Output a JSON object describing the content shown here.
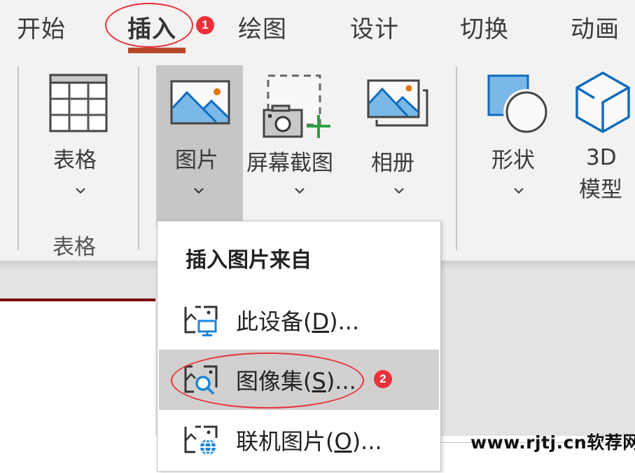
{
  "tabs": [
    {
      "label": "开始",
      "active": false
    },
    {
      "label": "插入",
      "active": true
    },
    {
      "label": "绘图",
      "active": false
    },
    {
      "label": "设计",
      "active": false
    },
    {
      "label": "切换",
      "active": false
    },
    {
      "label": "动画",
      "active": false
    }
  ],
  "annotations": {
    "step1": "1",
    "step2": "2",
    "color": "#e8313a"
  },
  "ribbon": {
    "groups": [
      {
        "name": "表格",
        "commands": [
          {
            "label": "表格",
            "icon": "table-icon",
            "has_dropdown": true
          }
        ]
      },
      {
        "name": "",
        "commands": [
          {
            "label": "图片",
            "icon": "picture-icon",
            "has_dropdown": true,
            "active": true
          },
          {
            "label": "屏幕截图",
            "icon": "screenshot-icon",
            "has_dropdown": true
          },
          {
            "label": "相册",
            "icon": "photo-album-icon",
            "has_dropdown": true
          }
        ]
      },
      {
        "name": "",
        "commands": [
          {
            "label": "形状",
            "icon": "shapes-icon",
            "has_dropdown": true
          },
          {
            "label_line1": "3D",
            "label_line2": "模型",
            "icon": "3d-model-icon",
            "has_dropdown": false
          }
        ]
      }
    ]
  },
  "picture_menu": {
    "title": "插入图片来自",
    "items": [
      {
        "text": "此设备(",
        "accel": "D",
        "suffix": ")...",
        "icon": "this-device-icon",
        "highlighted": false
      },
      {
        "text": "图像集(",
        "accel": "S",
        "suffix": ")...",
        "icon": "stock-images-icon",
        "highlighted": true
      },
      {
        "text": "联机图片(",
        "accel": "O",
        "suffix": ")...",
        "icon": "online-pictures-icon",
        "highlighted": false
      }
    ]
  },
  "colors": {
    "accent_tab": "#b7472a",
    "icon_blue": "#0f6cbd",
    "icon_fill_blue": "#7ab8e8",
    "orange_dot": "#e3730c",
    "plus_green": "#2ea043",
    "slide_bar": "#780a10"
  },
  "watermark": "www.rjtj.cn软荐网"
}
